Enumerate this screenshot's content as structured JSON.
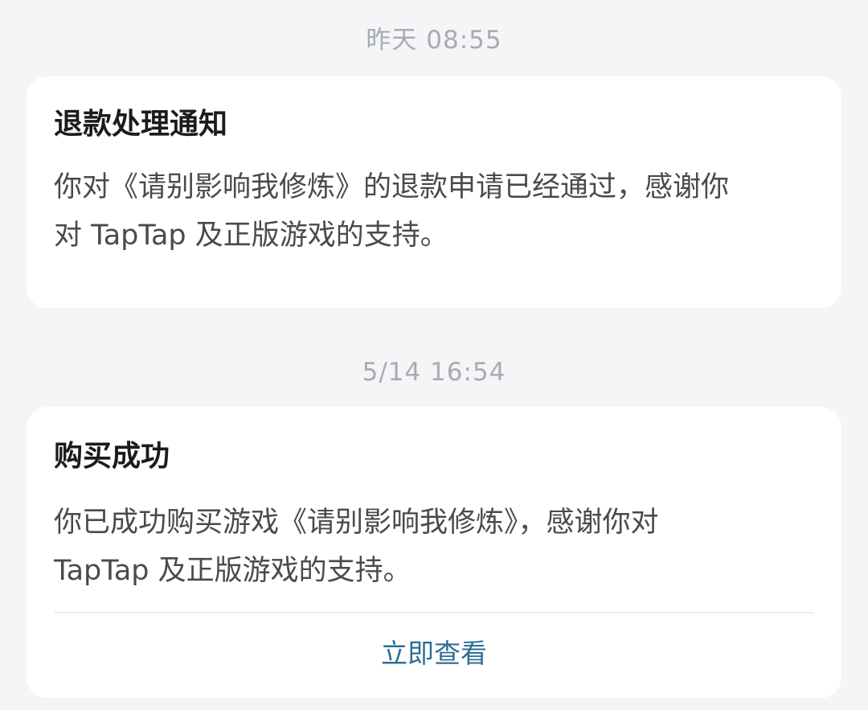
{
  "messages": [
    {
      "time": "昨天  08:55",
      "title": "退款处理通知",
      "body_line1": "你对《请别影响我修炼》的退款申请已经通过，感谢你",
      "body_line2": "对 TapTap 及正版游戏的支持。"
    },
    {
      "time": "5/14  16:54",
      "title": "购买成功",
      "body_line1": "你已成功购买游戏《请别影响我修炼》，感谢你对",
      "body_line2": "TapTap 及正版游戏的支持。",
      "action_label": "立即查看"
    }
  ],
  "colors": {
    "background": "#f4f5f7",
    "card": "#ffffff",
    "timestamp": "#a8abb1",
    "title": "#1b1b1b",
    "body": "#4a4a4a",
    "action_link": "#2f6e94"
  }
}
